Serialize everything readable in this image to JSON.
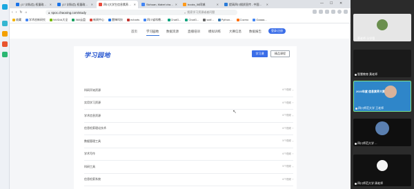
{
  "tabs": [
    {
      "title": "(17 封私信) 权量政务在...",
      "fav_color": "#1a73e8"
    },
    {
      "title": "(17 封私信) 权量政务在...",
      "fav_color": "#1a73e8"
    },
    {
      "title": "四川大学生信息素养大赛",
      "fav_color": "#e84a3b"
    },
    {
      "title": "Sichuan, Mabel chair - ...",
      "fav_color": "#4285f4"
    },
    {
      "title": "books_58同城",
      "fav_color": "#ff9a1a"
    },
    {
      "title": "提高四川搜质宣传 - 中国...",
      "fav_color": "#2a7bd8"
    }
  ],
  "address": {
    "url": "spoc.chaoxing.com/study",
    "search_placeholder": "搜索学习资源或者问题"
  },
  "bookmarks": [
    {
      "label": "收藏",
      "color": "#f4b400"
    },
    {
      "label": "学术创新研究",
      "color": "#4285f4"
    },
    {
      "label": "NVIDIA大全",
      "color": "#76b900"
    },
    {
      "label": "360云盘",
      "color": "#1aa260"
    },
    {
      "label": "新闻中心",
      "color": "#db4437"
    },
    {
      "label": "雷锋科技",
      "color": "#1a73e8"
    },
    {
      "label": "echarts",
      "color": "#c23531"
    },
    {
      "label": "四川省科教...",
      "color": "#4285f4"
    },
    {
      "label": "ChatG...",
      "color": "#10a37f"
    },
    {
      "label": "ChatG...",
      "color": "#10a37f"
    },
    {
      "label": "wolf...",
      "color": "#666666"
    },
    {
      "label": "Python...",
      "color": "#3776ab"
    },
    {
      "label": "Cozmo",
      "color": "#ff6d00"
    },
    {
      "label": "Gaaaa...",
      "color": "#4285f4"
    }
  ],
  "topnav": {
    "items": [
      "首页",
      "学习园地",
      "数据资源",
      "直播培训",
      "模拟训练",
      "大赛信息",
      "数据报告"
    ],
    "active_index": 1,
    "cta": "登录/注册"
  },
  "card": {
    "logo": "学习园地",
    "btn_primary": "学习课",
    "btn_secondary": "精品课程",
    "courses": [
      {
        "name": "科研开始资源",
        "count": "6个视频"
      },
      {
        "name": "实用学习资源",
        "count": "6个视频"
      },
      {
        "name": "学术信息资源",
        "count": "6个视频"
      },
      {
        "name": "信息检索理论技术",
        "count": "6个视频"
      },
      {
        "name": "数据管理工具",
        "count": "5个视频"
      },
      {
        "name": "学术写作",
        "count": "6个视频"
      },
      {
        "name": "科研工具",
        "count": "5个视频"
      },
      {
        "name": "信息检索系统",
        "count": "6个视频"
      }
    ]
  },
  "meeting": {
    "participants": [
      {
        "name": "蔡老师·分学管",
        "bg": "#e6e6e6"
      },
      {
        "name": "智慧教育 黄老师",
        "bg": "#1a1a1a"
      },
      {
        "name": "四川师范大学 王老师",
        "bg": "#2f86c9"
      },
      {
        "name": "四川师范大学 ...",
        "bg": "#0f0f0f"
      },
      {
        "name": "四川师范大学 周老师",
        "bg": "#111111"
      }
    ],
    "banner_text": "2023年度 信息素养大赛"
  }
}
